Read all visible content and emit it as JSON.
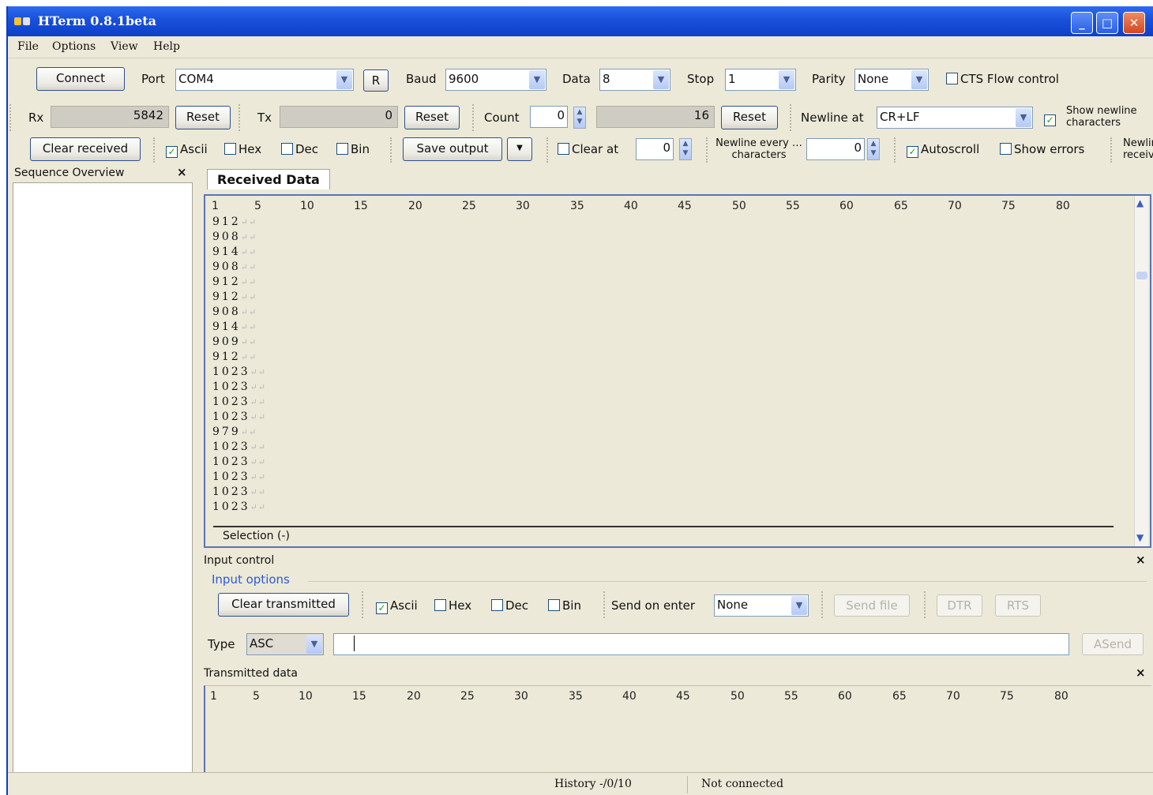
{
  "window": {
    "title": "HTerm 0.8.1beta",
    "min": "_",
    "max": "□",
    "close": "✕"
  },
  "menu": [
    "File",
    "Options",
    "View",
    "Help"
  ],
  "conn": {
    "connect": "Connect",
    "port_label": "Port",
    "port": "COM4",
    "r_button": "R",
    "baud_label": "Baud",
    "baud": "9600",
    "data_label": "Data",
    "data": "8",
    "stop_label": "Stop",
    "stop": "1",
    "parity_label": "Parity",
    "parity": "None",
    "cts": "CTS Flow control"
  },
  "counters": {
    "rx_label": "Rx",
    "rx": "5842",
    "reset": "Reset",
    "tx_label": "Tx",
    "tx": "0",
    "count_label": "Count",
    "count": "0",
    "count_total": "16",
    "newline_label": "Newline at",
    "newline": "CR+LF",
    "show_newline": "Show newline characters"
  },
  "rxopts": {
    "clear_received": "Clear received",
    "ascii": "Ascii",
    "hex": "Hex",
    "dec": "Dec",
    "bin": "Bin",
    "save_output": "Save output",
    "clear_at": "Clear at",
    "clear_at_value": "0",
    "newline_every": "Newline every … characters",
    "newline_every_value": "0",
    "autoscroll": "Autoscroll",
    "show_errors": "Show errors",
    "newline_received": "Newline received"
  },
  "sequence": {
    "title": "Sequence Overview",
    "close": "×"
  },
  "received": {
    "tab": "Received Data",
    "ruler": [
      "1",
      "5",
      "10",
      "15",
      "20",
      "25",
      "30",
      "35",
      "40",
      "45",
      "50",
      "55",
      "60",
      "65",
      "70",
      "75",
      "80"
    ],
    "lines": [
      "912",
      "908",
      "914",
      "908",
      "912",
      "912",
      "908",
      "914",
      "909",
      "912",
      "1023",
      "1023",
      "1023",
      "1023",
      "979",
      "1023",
      "1023",
      "1023",
      "1023",
      "1023"
    ],
    "selection": "Selection (-)"
  },
  "input": {
    "title": "Input control",
    "close": "×",
    "options": "Input options",
    "clear_transmitted": "Clear transmitted",
    "ascii": "Ascii",
    "hex": "Hex",
    "dec": "Dec",
    "bin": "Bin",
    "send_on_enter": "Send on enter",
    "send_on_enter_value": "None",
    "send_file": "Send file",
    "dtr": "DTR",
    "rts": "RTS",
    "type_label": "Type",
    "type": "ASC",
    "asend": "ASend"
  },
  "transmitted": {
    "title": "Transmitted data",
    "close": "×"
  },
  "status": {
    "history": "History -/0/10",
    "connection": "Not connected"
  }
}
